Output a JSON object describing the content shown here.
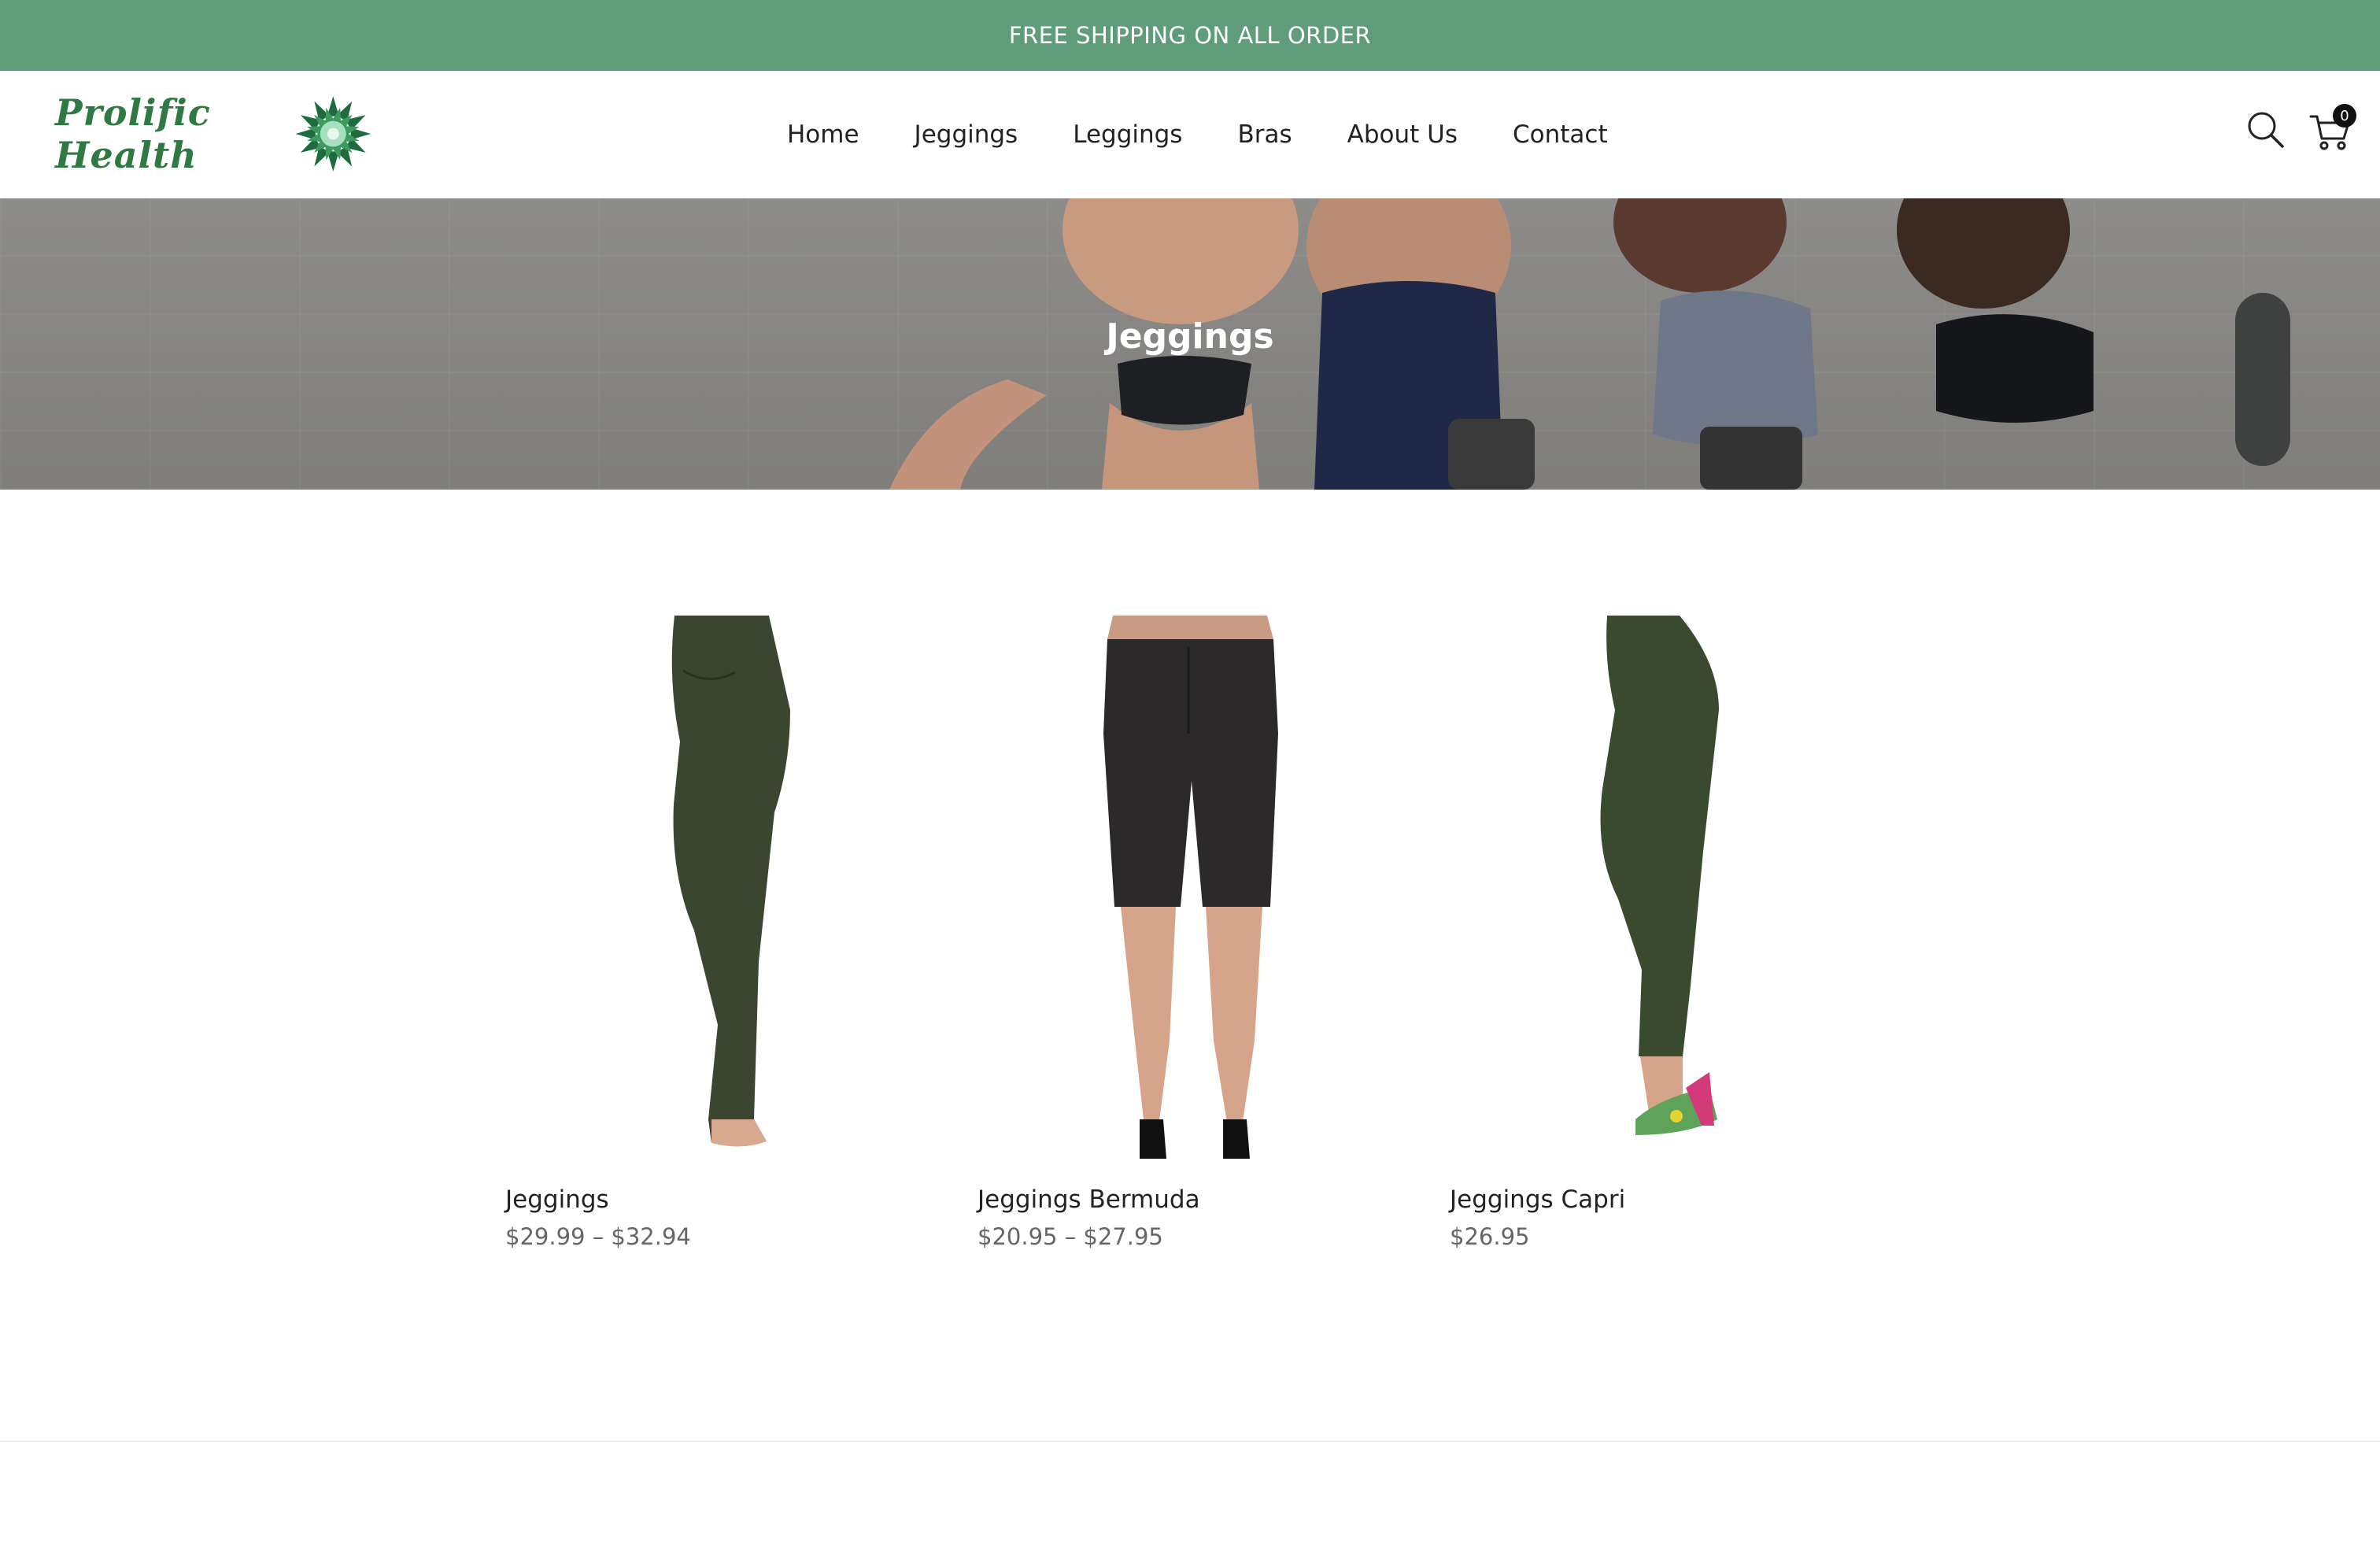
{
  "announcement": {
    "text": "FREE SHIPPING ON ALL ORDER"
  },
  "header": {
    "logo_text": "Prolific Health",
    "nav": [
      "Home",
      "Jeggings",
      "Leggings",
      "Bras",
      "About Us",
      "Contact"
    ],
    "cart_count": "0",
    "icons": {
      "search": "search-icon",
      "cart": "cart-icon",
      "logo_mark": "flower-logo-icon"
    }
  },
  "hero": {
    "title": "Jeggings"
  },
  "products": [
    {
      "name": "Jeggings",
      "price": "$29.99 – $32.94",
      "color": "#3c4a32"
    },
    {
      "name": "Jeggings Bermuda",
      "price": "$20.95 – $27.95",
      "color": "#2e2c2d"
    },
    {
      "name": "Jeggings Capri",
      "price": "$26.95",
      "color": "#3a4a2f"
    }
  ],
  "colors": {
    "accent": "#5e9c7a",
    "brand_green": "#2f7a43"
  }
}
